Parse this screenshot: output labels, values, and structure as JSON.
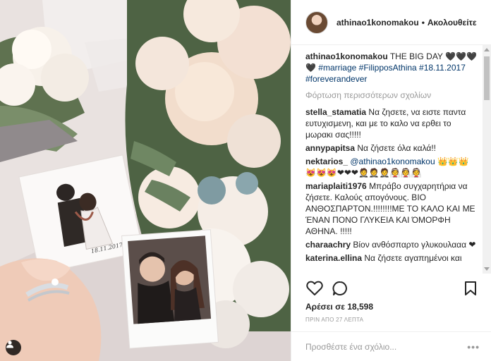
{
  "header": {
    "username": "athinao1konomakou",
    "separator": "•",
    "follow_label": "Ακολουθείτε"
  },
  "caption": {
    "username": "athinao1konomakou",
    "text": "THE BIG DAY ",
    "emoji": "🖤🖤🖤🖤",
    "hashtags": "#marriage #FilipposAthina #18.11.2017 #foreverandever"
  },
  "load_more_label": "Φόρτωση περισσότερων σχολίων",
  "comments": [
    {
      "username": "stella_stamatia",
      "text": "Να ζησετε, να ειστε παντα ευτυχισμενη, και με το καλο να ερθει το μωρακι σας!!!!!"
    },
    {
      "username": "annypapitsa",
      "text": "Να ζήσετε όλα καλά!!"
    },
    {
      "username": "nektarios_",
      "text": " 👑👑👑😻😻😻❤❤❤🤵🤵🤵👰👰👰",
      "mention": "@athinao1konomakou"
    },
    {
      "username": "mariaplaiti1976",
      "text": "Μπράβο συγχαρητήρια να ζήσετε. Καλούς απογόνους. ΒΙΟ ΑΝΘΟΣΠΑΡΤΟΝ.!!!!!!!!ΜΕ ΤΟ ΚΑΛΟ ΚΑΙ ΜΕ ΈΝΑΝ ΠΟΝΟ ΓΛΥΚΕΙΑ ΚΑΙ ΌΜΟΡΦΗ ΑΘΗΝΑ. !!!!!"
    },
    {
      "username": "charaachry",
      "text": "Βίον ανθόσπαρτο γλυκουλααα ❤"
    },
    {
      "username": "katerina.ellina",
      "text": "Να ζήσετε αγαπημένοι και"
    }
  ],
  "likes_text": "Αρέσει σε 18,598",
  "timestamp": "ΠΡΙΝ ΑΠΟ 27 ΛΕΠΤΑ",
  "add_comment_placeholder": "Προσθέστε ένα σχόλιο...",
  "more_options": "•••",
  "colors": {
    "link": "#003569",
    "muted": "#999999",
    "heart": "#ed4956"
  },
  "icons": {
    "like": "heart-outline-icon",
    "comment": "speech-bubble-icon",
    "save": "bookmark-icon",
    "tag": "person-tag-icon"
  }
}
